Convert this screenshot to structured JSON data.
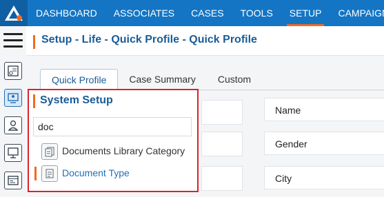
{
  "nav": {
    "items": [
      {
        "label": "DASHBOARD",
        "active": false
      },
      {
        "label": "ASSOCIATES",
        "active": false
      },
      {
        "label": "CASES",
        "active": false
      },
      {
        "label": "TOOLS",
        "active": false
      },
      {
        "label": "SETUP",
        "active": true
      },
      {
        "label": "CAMPAIGN",
        "active": false
      }
    ]
  },
  "sidebar": {
    "icons": [
      "profile-card-icon",
      "monitor-user-icon",
      "user-icon",
      "presentation-icon",
      "browser-window-icon"
    ],
    "active_index": 1
  },
  "page": {
    "title": "Setup - Life - Quick Profile - Quick Profile"
  },
  "tabs": [
    {
      "label": "Quick Profile",
      "active": true
    },
    {
      "label": "Case Summary",
      "active": false
    },
    {
      "label": "Custom",
      "active": false
    }
  ],
  "form": {
    "fields": [
      "Name",
      "Gender",
      "City"
    ]
  },
  "popup": {
    "title": "System Setup",
    "search_value": "doc",
    "results": [
      {
        "label": "Documents Library Category",
        "selected": false
      },
      {
        "label": "Document Type",
        "selected": true
      }
    ]
  },
  "colors": {
    "nav_bg": "#1475c4",
    "accent": "#f26a21",
    "highlight_border": "#e0202c",
    "link_blue": "#1a5c96"
  }
}
